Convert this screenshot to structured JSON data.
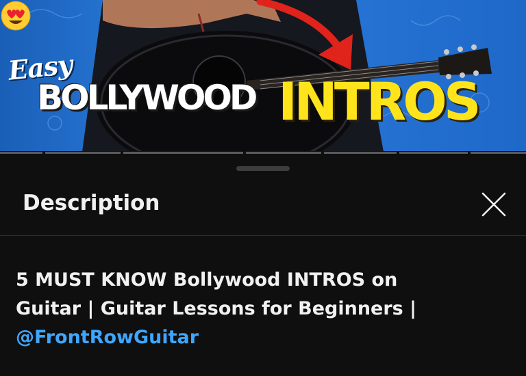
{
  "thumbnail": {
    "word_easy": "Easy",
    "word_bollywood": "BOLLYWOOD",
    "word_intros": "INTROS",
    "emoji": "😍",
    "colors": {
      "background": "#2b7fe0",
      "intros": "#ffe41c",
      "arrow": "#e0231b"
    }
  },
  "sheet": {
    "title": "Description",
    "close_icon": "close-icon",
    "description": {
      "line1": "5 MUST KNOW Bollywood INTROS on",
      "line2": "Guitar | Guitar Lessons for Beginners |",
      "channel_handle": "@FrontRowGuitar"
    },
    "colors": {
      "background": "#0f0f0f",
      "text": "#f1f1f1",
      "link": "#3ea6ff"
    }
  }
}
